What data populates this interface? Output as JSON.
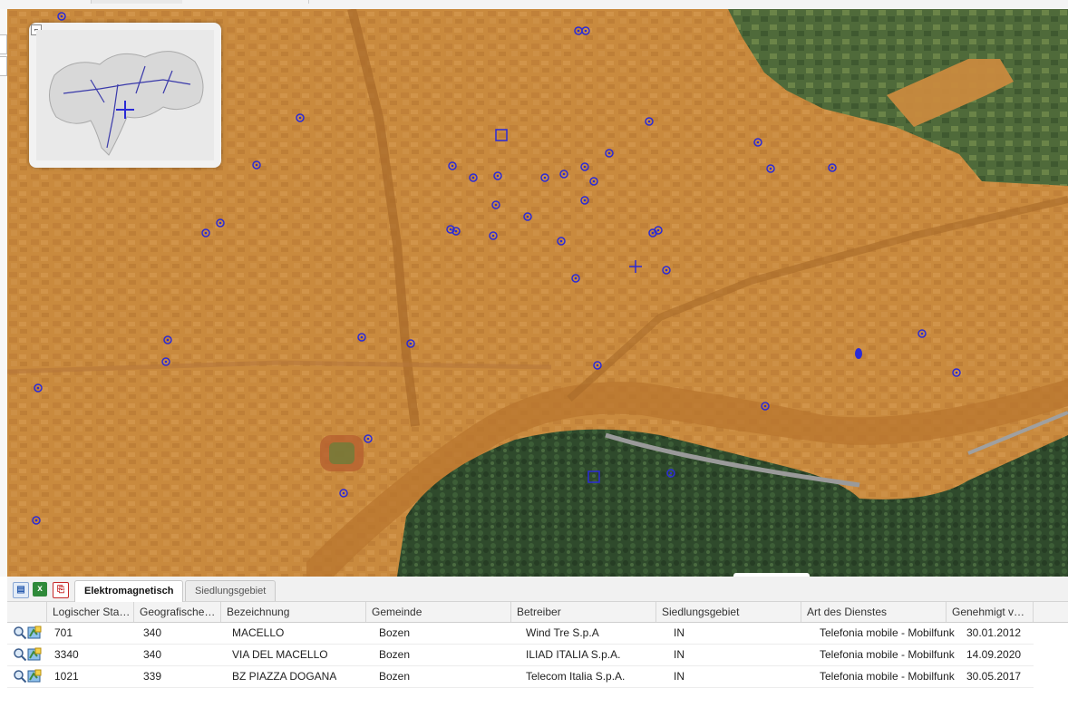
{
  "map": {
    "overview_toggle": "⌐",
    "collapse_icon": "⌄"
  },
  "colors": {
    "overlay": "#c98a3e",
    "marker": "#2b2bd6",
    "forest": "#2f4a2c",
    "highlight_row": "#ffffff"
  },
  "toolbar": {
    "icons": [
      "grid-icon",
      "excel-icon",
      "pdf-icon"
    ]
  },
  "tabs": [
    {
      "label": "Elektromagnetisch",
      "active": true
    },
    {
      "label": "Siedlungsgebiet",
      "active": false
    }
  ],
  "table": {
    "columns": [
      "Logischer Sta…",
      "Geografische…",
      "Bezeichnung",
      "Gemeinde",
      "Betreiber",
      "Siedlungsgebiet",
      "Art des Dienstes",
      "Genehmigt v…"
    ],
    "rows": [
      [
        "701",
        "340",
        "MACELLO",
        "Bozen",
        "Wind Tre S.p.A",
        "IN",
        "Telefonia mobile - Mobilfunk",
        "30.01.2012"
      ],
      [
        "3340",
        "340",
        "VIA DEL MACELLO",
        "Bozen",
        "ILIAD ITALIA S.p.A.",
        "IN",
        "Telefonia mobile - Mobilfunk",
        "14.09.2020"
      ],
      [
        "1021",
        "339",
        "BZ PIAZZA DOGANA",
        "Bozen",
        "Telecom Italia S.p.A.",
        "IN",
        "Telefonia mobile - Mobilfunk",
        "30.05.2017"
      ]
    ]
  }
}
